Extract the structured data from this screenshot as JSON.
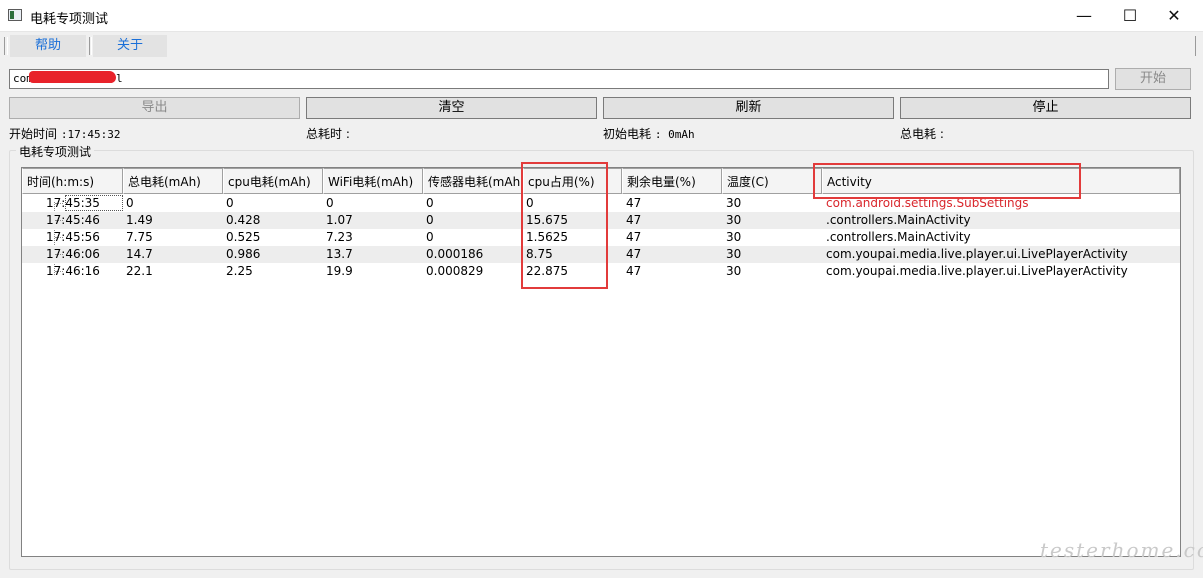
{
  "window": {
    "title": "电耗专项测试",
    "minimize_glyph": "—",
    "maximize_glyph": "☐",
    "close_glyph": "✕"
  },
  "menu": {
    "items": [
      {
        "label": "帮助"
      },
      {
        "label": "关于"
      }
    ]
  },
  "package_input": {
    "value": "com",
    "tail": "l"
  },
  "buttons": {
    "start": "开始",
    "export": "导出",
    "clear": "清空",
    "refresh": "刷新",
    "stop": "停止"
  },
  "stats": {
    "start_time_label": "开始时间",
    "start_time_value": ":17:45:32",
    "total_time_label": "总耗时 :",
    "initial_power_label": "初始电耗",
    "initial_power_value": ": 0mAh",
    "total_power_label": "总电耗 :"
  },
  "group": {
    "label": "电耗专项测试"
  },
  "table": {
    "columns": [
      "时间(h:m:s)",
      "总电耗(mAh)",
      "cpu电耗(mAh)",
      "WiFi电耗(mAh)",
      "传感器电耗(mAh)",
      "cpu占用(%)",
      "剩余电量(%)",
      "温度(C)",
      "Activity"
    ],
    "rows": [
      [
        "17:45:35",
        "0",
        "0",
        "0",
        "0",
        "0",
        "47",
        "30",
        "com.android.settings.SubSettings"
      ],
      [
        "17:45:46",
        "1.49",
        "0.428",
        "1.07",
        "0",
        "15.675",
        "47",
        "30",
        ".controllers.MainActivity"
      ],
      [
        "17:45:56",
        "7.75",
        "0.525",
        "7.23",
        "0",
        "1.5625",
        "47",
        "30",
        ".controllers.MainActivity"
      ],
      [
        "17:46:06",
        "14.7",
        "0.986",
        "13.7",
        "0.000186",
        "8.75",
        "47",
        "30",
        "com.youpai.media.live.player.ui.LivePlayerActivity"
      ],
      [
        "17:46:16",
        "22.1",
        "2.25",
        "19.9",
        "0.000829",
        "22.875",
        "47",
        "30",
        "com.youpai.media.live.player.ui.LivePlayerActivity"
      ]
    ]
  },
  "watermark": "testerhome.com",
  "colors": {
    "highlight_box": "#e23b3b",
    "menu_text": "#1a6fd8",
    "redaction": "#e8222a"
  }
}
